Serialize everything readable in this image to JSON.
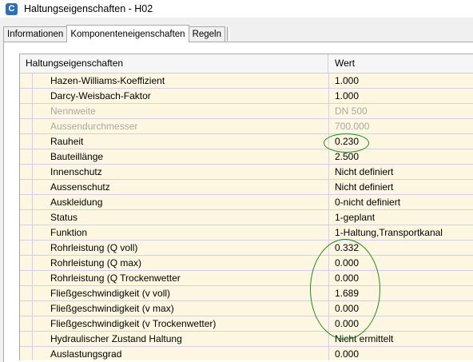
{
  "window": {
    "title": "Haltungseigenschaften - H02",
    "app_icon_letter": "C"
  },
  "tabs": [
    {
      "label": "Informationen"
    },
    {
      "label": "Komponenteneigenschaften"
    },
    {
      "label": "Regeln"
    }
  ],
  "grid": {
    "header_name": "Haltungseigenschaften",
    "header_value": "Wert",
    "rows": [
      {
        "name": "Hazen-Williams-Koeffizient",
        "value": "1.000"
      },
      {
        "name": "Darcy-Weisbach-Faktor",
        "value": "1.000"
      },
      {
        "name": "Nennweite",
        "value": "DN 500",
        "disabled": true
      },
      {
        "name": "Aussendurchmesser",
        "value": "700.000",
        "disabled": true
      },
      {
        "name": "Rauheit",
        "value": "0.230"
      },
      {
        "name": "Bauteillänge",
        "value": "2.500"
      },
      {
        "name": "Innenschutz",
        "value": "Nicht definiert"
      },
      {
        "name": "Aussenschutz",
        "value": "Nicht definiert"
      },
      {
        "name": "Auskleidung",
        "value": "0-nicht definiert"
      },
      {
        "name": "Status",
        "value": "1-geplant"
      },
      {
        "name": "Funktion",
        "value": "1-Haltung,Transportkanal"
      },
      {
        "name": "Rohrleistung (Q voll)",
        "value": "0.332"
      },
      {
        "name": "Rohrleistung (Q max)",
        "value": "0.000"
      },
      {
        "name": "Rohrleistung (Q Trockenwetter",
        "value": "0.000"
      },
      {
        "name": "Fließgeschwindigkeit (v voll)",
        "value": "1.689"
      },
      {
        "name": "Fließgeschwindigkeit (v max)",
        "value": "0.000"
      },
      {
        "name": "Fließgeschwindigkeit (v Trockenwetter)",
        "value": "0.000"
      },
      {
        "name": "Hydraulischer Zustand Haltung",
        "value": "Nicht ermittelt"
      },
      {
        "name": "Auslastungsgrad",
        "value": "0.000"
      }
    ]
  },
  "colors": {
    "grid_background": "#fdf7e2",
    "annotation_green": "#1f8a1f",
    "disabled_text": "#a8a8a8"
  }
}
